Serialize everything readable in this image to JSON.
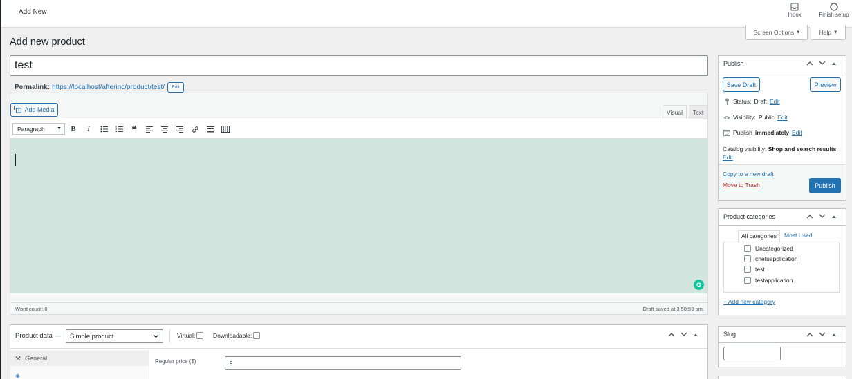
{
  "topbar": {
    "add_new": "Add New",
    "inbox": "Inbox",
    "finish_setup": "Finish setup"
  },
  "screen_options": "Screen Options",
  "help": "Help",
  "page_title": "Add new product",
  "post_title": "test",
  "permalink": {
    "label": "Permalink:",
    "url": "https://localhost/afterinc/product/test/",
    "edit": "Edit"
  },
  "editor": {
    "add_media": "Add Media",
    "tab_visual": "Visual",
    "tab_text": "Text",
    "format": "Paragraph",
    "word_count": "Word count: 0",
    "draft_saved": "Draft saved at 3:50:59 pm.",
    "bg_color": "#d2e5df"
  },
  "product_data": {
    "label": "Product data —",
    "type": "Simple product",
    "virtual": "Virtual:",
    "downloadable": "Downloadable:",
    "tab_general": "General",
    "regular_price_label": "Regular price ($)",
    "regular_price_value": "9"
  },
  "publish": {
    "title": "Publish",
    "save_draft": "Save Draft",
    "preview": "Preview",
    "status_label": "Status:",
    "status_value": "Draft",
    "visibility_label": "Visibility:",
    "visibility_value": "Public",
    "publish_label": "Publish",
    "publish_value": "immediately",
    "catalog_label": "Catalog visibility:",
    "catalog_value": "Shop and search results",
    "edit": "Edit",
    "copy_draft": "Copy to a new draft",
    "move_trash": "Move to Trash",
    "publish_button": "Publish",
    "accent": "#2271b1",
    "trash_color": "#b32d2e"
  },
  "categories": {
    "title": "Product categories",
    "tab_all": "All categories",
    "tab_most_used": "Most Used",
    "items": [
      "Uncategorized",
      "chetuapplication",
      "test",
      "testapplication"
    ],
    "add_new": "+ Add new category"
  },
  "slug": {
    "title": "Slug",
    "value": ""
  }
}
